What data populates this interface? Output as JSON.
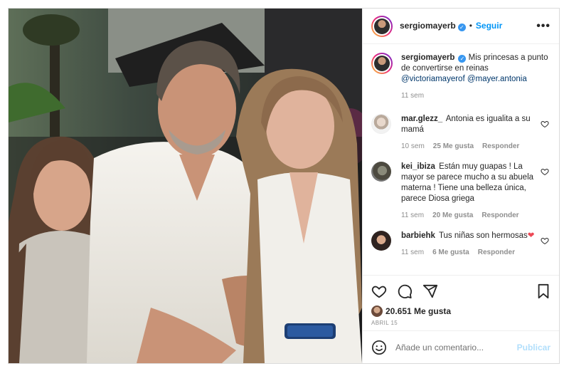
{
  "post": {
    "author": "sergiomayerb",
    "follow_label": "Seguir",
    "more_label": "•••",
    "separator": "•"
  },
  "caption": {
    "author": "sergiomayerb",
    "text": "Mis princesas a punto de convertirse en reinas",
    "mentions": "@victoriamayerof @mayer.antonia",
    "time": "11 sem"
  },
  "comments": [
    {
      "user": "mar.glezz_",
      "text": "Antonia es igualita a su mamá",
      "time": "10 sem",
      "likes": "25 Me gusta",
      "reply": "Responder"
    },
    {
      "user": "kei_ibiza",
      "text": "Están muy guapas ! La mayor se parece mucho a su abuela materna ! Tiene una belleza única, parece Diosa griega",
      "time": "11 sem",
      "likes": "20 Me gusta",
      "reply": "Responder"
    },
    {
      "user": "barbiehk",
      "text": "Tus niñas son hermosas",
      "time": "11 sem",
      "likes": "6 Me gusta",
      "reply": "Responder"
    }
  ],
  "engagement": {
    "likes": "20.651 Me gusta",
    "date": "ABRIL 15"
  },
  "composer": {
    "placeholder": "Añade un comentario...",
    "publish_label": "Publicar"
  },
  "colors": {
    "accent": "#0095f6",
    "verified": "#3897f0",
    "heart": "#ed4956",
    "muted": "#8e8e8e"
  },
  "icons": [
    "verified-icon",
    "more-icon",
    "heart-icon",
    "comment-icon",
    "share-icon",
    "bookmark-icon",
    "emoji-icon"
  ]
}
